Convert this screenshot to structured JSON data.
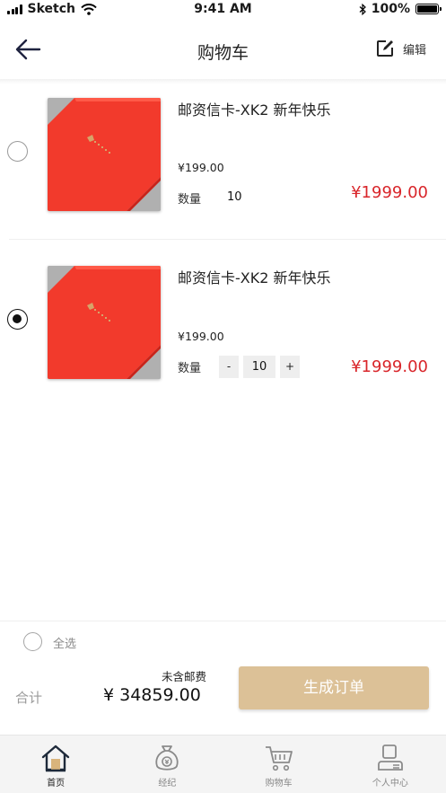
{
  "status_bar": {
    "carrier": "Sketch",
    "time": "9:41 AM",
    "battery": "100%"
  },
  "nav": {
    "title": "购物车",
    "edit_label": "编辑",
    "back_icon": "arrow-left-icon",
    "edit_icon": "edit-icon"
  },
  "cart": {
    "items": [
      {
        "title": "邮资信卡-XK2 新年快乐",
        "unit_price": "¥199.00",
        "qty_label": "数量",
        "qty": "10",
        "total": "¥1999.00",
        "selected": false
      },
      {
        "title": "邮资信卡-XK2 新年快乐",
        "unit_price": "¥199.00",
        "qty_label": "数量",
        "qty": "10",
        "minus": "-",
        "plus": "+",
        "total": "¥1999.00",
        "selected": true
      }
    ]
  },
  "footer": {
    "select_all": "全选",
    "total_label": "合计",
    "shipping_note": "未含邮费",
    "total_amount": "¥  34859.00",
    "submit": "生成订单"
  },
  "tabbar": {
    "tabs": [
      {
        "label": "首页",
        "icon": "home-icon",
        "active": true
      },
      {
        "label": "经纪",
        "icon": "money-bag-icon",
        "active": false
      },
      {
        "label": "购物车",
        "icon": "cart-icon",
        "active": false
      },
      {
        "label": "个人中心",
        "icon": "user-center-icon",
        "active": false
      }
    ]
  },
  "colors": {
    "price_red": "#d9262b",
    "submit_gold": "#dcc197",
    "product_red": "#f23a2c"
  }
}
